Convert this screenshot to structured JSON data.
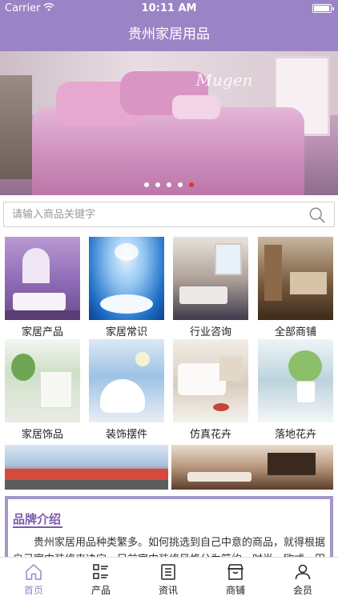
{
  "status_bar": {
    "carrier": "Carrier",
    "time": "10:11 AM",
    "icons": [
      "wifi-icon",
      "battery-icon"
    ]
  },
  "nav": {
    "title": "贵州家居用品"
  },
  "banner": {
    "overlay_text": "Mugen",
    "slide_count": 5,
    "active_slide": 5
  },
  "search": {
    "placeholder": "请输入商品关键字",
    "value": ""
  },
  "categories": [
    {
      "label": "家居产品"
    },
    {
      "label": "家居常识"
    },
    {
      "label": "行业咨询"
    },
    {
      "label": "全部商铺"
    },
    {
      "label": "家居饰品"
    },
    {
      "label": "装饰摆件"
    },
    {
      "label": "仿真花卉"
    },
    {
      "label": "落地花卉"
    }
  ],
  "brand_intro": {
    "title": "品牌介绍",
    "body": "贵州家居用品种类繁多。如何挑选到自己中意的商品，就得根据自己室内装修来决定，目前室内装修风格分为简约、时尚、欧式、田园等几"
  },
  "tab_bar": [
    {
      "label": "首页",
      "icon": "home-icon",
      "active": true
    },
    {
      "label": "产品",
      "icon": "products-grid-icon",
      "active": false
    },
    {
      "label": "资讯",
      "icon": "news-document-icon",
      "active": false
    },
    {
      "label": "商铺",
      "icon": "store-icon",
      "active": false
    },
    {
      "label": "会员",
      "icon": "user-icon",
      "active": false
    }
  ],
  "colors": {
    "primary": "#9b84c5",
    "brand_title": "#7b5aa8",
    "card_border": "#a496c9",
    "active_dot": "#e0332c"
  }
}
